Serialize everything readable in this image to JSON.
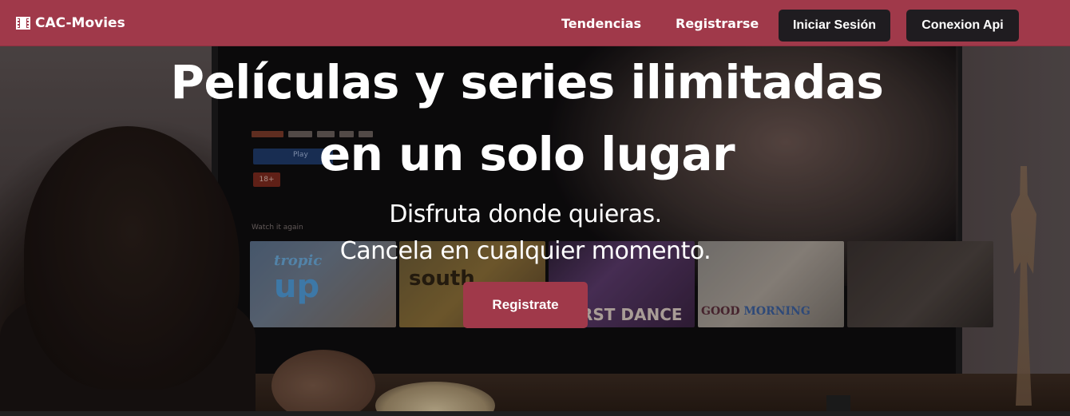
{
  "navbar": {
    "brand": "CAC-Movies",
    "brand_icon": "film-icon",
    "links": {
      "tendencias": "Tendencias",
      "registrarse": "Registrarse"
    },
    "buttons": {
      "iniciar_sesion": "Iniciar Sesión",
      "conexion_api": "Conexion Api"
    },
    "colors": {
      "background": "#a0394a",
      "button_bg": "#1f1c20"
    }
  },
  "hero": {
    "title_line1": "Películas y series ilimitadas",
    "title_line2": "en un solo lugar",
    "subtitle_line1": "Disfruta donde quieras.",
    "subtitle_line2": "Cancela en cualquier momento.",
    "cta_label": "Registrate",
    "cta_color": "#a0394a"
  },
  "background_tv": {
    "play_label": "Play",
    "rating": "18+",
    "row_label": "Watch it again",
    "thumbnails": [
      {
        "line1": "tropic",
        "line2": "up"
      },
      {
        "line1": "south"
      },
      {
        "line1": "RST DANCE"
      },
      {
        "line1": "GOOD",
        "line2": "MORNING"
      }
    ]
  }
}
